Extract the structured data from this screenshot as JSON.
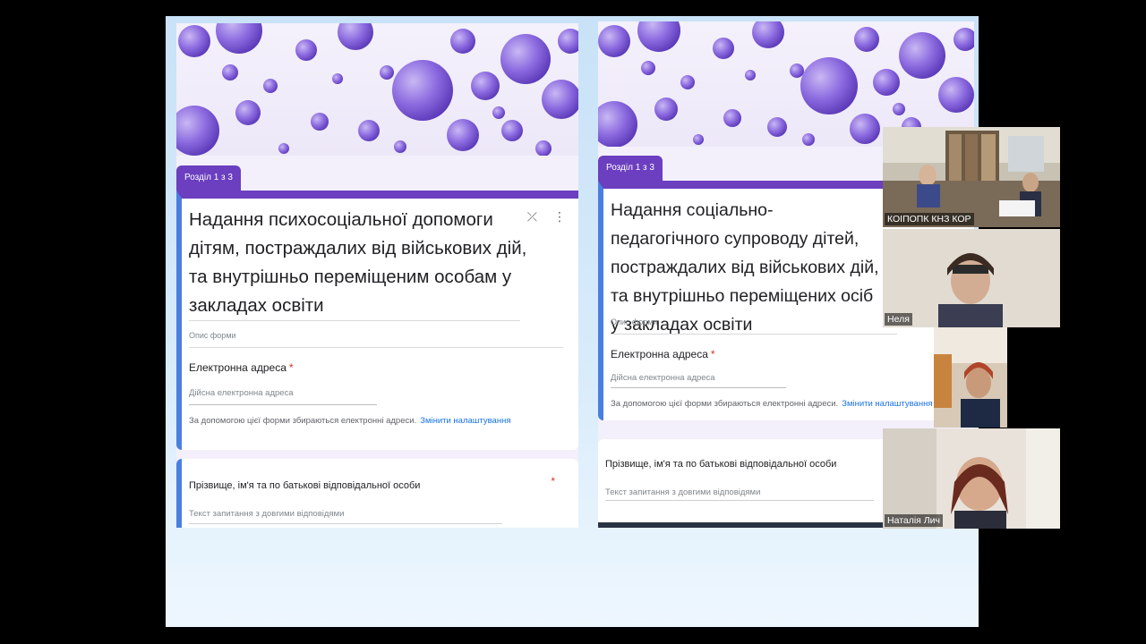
{
  "forms": [
    {
      "section_tab": "Розділ 1 з 3",
      "title": "Надання психосоціальної допомоги дітям, постраждалих від військових дій, та внутрішньо переміщеним особам у закладах освіти",
      "description_placeholder": "Опис форми",
      "email_label": "Електронна адреса",
      "required_mark": "*",
      "email_hint": "Дійсна електронна адреса",
      "collect_note": "За допомогою цієї форми збираються електронні адреси.",
      "change_settings_link": "Змінити налаштування",
      "question_label": "Прізвище, ім'я та по батькові відповідальної особи",
      "question_required": "*",
      "question_hint": "Текст запитання з довгими відповідями",
      "icons": [
        "collapse-icon",
        "more-vert-icon"
      ]
    },
    {
      "section_tab": "Розділ 1 з 3",
      "title": "Надання соціально-педагогічного супроводу дітей, постраждалих від військових дій, та внутрішньо переміщених осіб у закладах освіти",
      "description_placeholder": "Опис форми",
      "email_label": "Електронна адреса",
      "required_mark": "*",
      "email_hint": "Дійсна електронна адреса",
      "collect_note": "За допомогою цієї форми збираються електронні адреси.",
      "change_settings_link": "Змінити налаштування",
      "question_label": "Прізвище, ім'я та по батькові відповідальної особи",
      "question_hint": "Текст запитання з довгими відповідями"
    }
  ],
  "participants": [
    {
      "name": "КОІПОПК КНЗ КОР"
    },
    {
      "name": "Неля"
    },
    {
      "name": ""
    },
    {
      "name": "Наталія Лич"
    }
  ],
  "colors": {
    "accent": "#6b3fbf",
    "question_border": "#4a7fe0",
    "link": "#1a73e8",
    "required": "#d93025",
    "screen_bg": "#c9e2f7"
  }
}
